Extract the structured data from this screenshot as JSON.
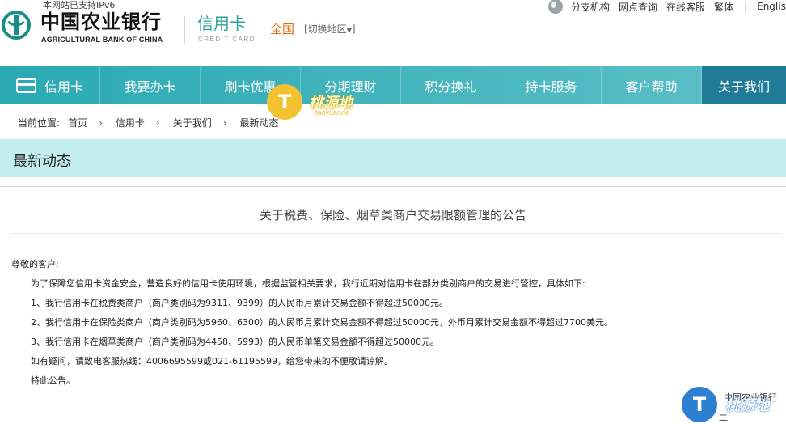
{
  "header": {
    "ipv6_notice": "本网站已支持IPv6",
    "bank_name_cn": "中国农业银行",
    "bank_name_en": "AGRICULTURAL BANK OF CHINA",
    "product_cn": "信用卡",
    "product_en": "CREDIT CARD",
    "region": "全国",
    "region_switch": "[切换地区",
    "region_switch_end": "]",
    "top_links": [
      "分支机构",
      "网点查询",
      "在线客服",
      "繁体",
      "English"
    ],
    "top_links_separator": "|"
  },
  "nav": {
    "items": [
      "信用卡",
      "我要办卡",
      "刷卡优惠",
      "分期理财",
      "积分换礼",
      "持卡服务",
      "客户帮助",
      "关于我们"
    ],
    "active_index": 7
  },
  "breadcrumb": {
    "label": "当前位置:",
    "items": [
      "首页",
      "信用卡",
      "关于我们",
      "最新动态"
    ]
  },
  "section": {
    "title": "最新动态"
  },
  "notice": {
    "title": "关于税费、保险、烟草类商户交易限额管理的公告",
    "greeting": "尊敬的客户:",
    "paragraphs": [
      "为了保障您信用卡资金安全，营造良好的信用卡使用环境，根据监管相关要求，我行近期对信用卡在部分类别商户的交易进行管控，具体如下:",
      "1、我行信用卡在税费类商户（商户类别码为9311、9399）的人民币月累计交易金额不得超过50000元。",
      "2、我行信用卡在保险类商户（商户类别码为5960、6300）的人民币月累计交易金额不得超过50000元，外币月累计交易金额不得超过7700美元。",
      "3、我行信用卡在烟草类商户（商户类别码为4458、5993）的人民币单笔交易金额不得超过50000元。",
      "如有疑问，请致电客服热线：4006695599或021-61195599，给您带来的不便敬请谅解。",
      "特此公告。"
    ]
  },
  "footer": {
    "line1": "中国农业银行",
    "line2": "二"
  },
  "watermark": {
    "glyph": "T",
    "text": "桃源地",
    "sub": "taoyuande"
  },
  "colors": {
    "nav_start": "#2aa9b3",
    "nav_active": "#1f7b97",
    "section_bg": "#c3eef1",
    "accent_teal": "#2ba39a",
    "region_orange": "#e36c0a"
  }
}
